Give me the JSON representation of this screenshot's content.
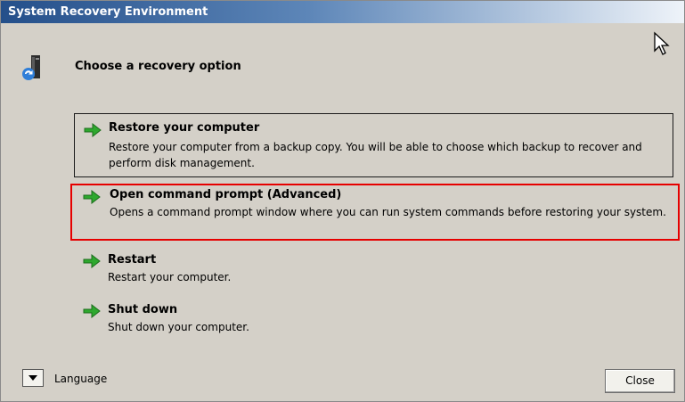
{
  "window": {
    "title": "System Recovery Environment"
  },
  "header": {
    "icon": "recovery-tower-icon",
    "title": "Choose a recovery option"
  },
  "options": [
    {
      "label": "Restore your computer",
      "description": "Restore your computer from a backup copy. You will be able to choose which backup to recover and perform disk management.",
      "icon": "green-arrow-icon"
    },
    {
      "label": "Open command prompt (Advanced)",
      "description": "Opens a command prompt window where you can run system commands before restoring your system.",
      "icon": "green-arrow-icon",
      "highlighted": true
    },
    {
      "label": "Restart",
      "description": "Restart your computer.",
      "icon": "green-arrow-icon"
    },
    {
      "label": "Shut down",
      "description": "Shut down your computer.",
      "icon": "green-arrow-icon"
    }
  ],
  "footer": {
    "language_label": "Language",
    "close_label": "Close"
  },
  "colors": {
    "title_bar": "#244f8a",
    "background": "#d4d0c8",
    "highlight_border": "#e60000",
    "arrow_green": "#2ea82e"
  }
}
